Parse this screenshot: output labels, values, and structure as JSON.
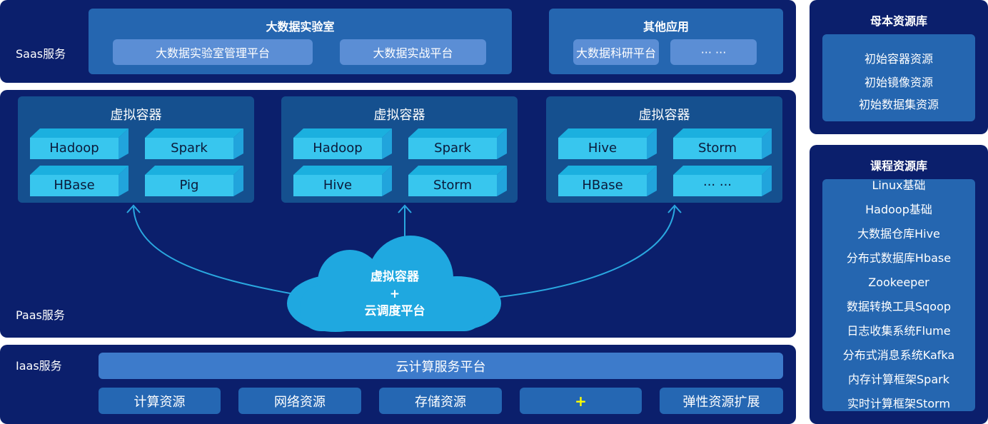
{
  "saas": {
    "label": "Saas服务",
    "lab": {
      "title": "大数据实验室",
      "items": [
        "大数据实验室管理平台",
        "大数据实战平台"
      ]
    },
    "other": {
      "title": "其他应用",
      "items": [
        "大数据科研平台",
        "··· ···"
      ]
    }
  },
  "paas": {
    "label": "Paas服务",
    "containers": [
      {
        "title": "虚拟容器",
        "cubes": [
          "Hadoop",
          "Spark",
          "HBase",
          "Pig"
        ]
      },
      {
        "title": "虚拟容器",
        "cubes": [
          "Hadoop",
          "Spark",
          "Hive",
          "Storm"
        ]
      },
      {
        "title": "虚拟容器",
        "cubes": [
          "Hive",
          "Storm",
          "HBase",
          "··· ···"
        ]
      }
    ],
    "cloud": {
      "line1": "虚拟容器",
      "line2": "+",
      "line3": "云调度平台"
    }
  },
  "iaas": {
    "label": "Iaas服务",
    "platform": "云计算服务平台",
    "resources": [
      "计算资源",
      "网络资源",
      "存储资源",
      "+",
      "弹性资源扩展"
    ]
  },
  "mother": {
    "title": "母本资源库",
    "items": [
      "初始容器资源",
      "初始镜像资源",
      "初始数据集资源"
    ]
  },
  "course": {
    "title": "课程资源库",
    "items": [
      "Linux基础",
      "Hadoop基础",
      "大数据仓库Hive",
      "分布式数据库Hbase",
      "Zookeeper",
      "数据转换工具Sqoop",
      "日志收集系统Flume",
      "分布式消息系统Kafka",
      "内存计算框架Spark",
      "实时计算框架Storm"
    ]
  },
  "colors": {
    "panel": "#0b1f6c",
    "box": "#2566b0",
    "button": "#5b8ed5",
    "container": "#15508f",
    "cube": "#38c6ee",
    "cloud": "#1fa8e0",
    "plus": "#ffff00"
  }
}
